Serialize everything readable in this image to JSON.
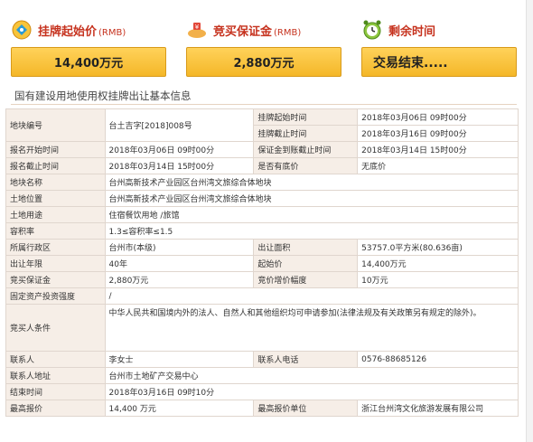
{
  "stats": {
    "start_price": {
      "label": "挂牌起始价",
      "unit": "(RMB)",
      "value": "14,400万元"
    },
    "deposit": {
      "label": "竞买保证金",
      "unit": "(RMB)",
      "value": "2,880万元"
    },
    "remaining": {
      "label": "剩余时间",
      "value": "交易结束....."
    }
  },
  "section_title": "国有建设用地使用权挂牌出让基本信息",
  "rows": {
    "r1": {
      "l1": "地块编号",
      "v1": "台土吉字[2018]008号",
      "l2": "挂牌起始时间",
      "v2": "2018年03月06日 09时00分"
    },
    "r1b": {
      "l2": "挂牌截止时间",
      "v2": "2018年03月16日 09时00分"
    },
    "r2": {
      "l1": "报名开始时间",
      "v1": "2018年03月06日 09时00分",
      "l2": "保证金到账截止时间",
      "v2": "2018年03月14日 15时00分"
    },
    "r3": {
      "l1": "报名截止时间",
      "v1": "2018年03月14日 15时00分",
      "l2": "是否有底价",
      "v2": "无底价"
    },
    "r4": {
      "l1": "地块名称",
      "v1": "台州高新技术产业园区台州湾文旅综合体地块"
    },
    "r5": {
      "l1": "土地位置",
      "v1": "台州高新技术产业园区台州湾文旅综合体地块"
    },
    "r6": {
      "l1": "土地用途",
      "v1": "住宿餐饮用地 /旅馆"
    },
    "r7": {
      "l1": "容积率",
      "v1": "1.3≤容积率≤1.5"
    },
    "r8": {
      "l1": "所属行政区",
      "v1": "台州市(本级)",
      "l2": "出让面积",
      "v2": "53757.0平方米(80.636亩)"
    },
    "r9": {
      "l1": "出让年限",
      "v1": "40年",
      "l2": "起始价",
      "v2": "14,400万元"
    },
    "r10": {
      "l1": "竞买保证金",
      "v1": "2,880万元",
      "l2": "竞价增价幅度",
      "v2": "10万元"
    },
    "r11": {
      "l1": "固定资产投资强度",
      "v1": "/"
    },
    "r12": {
      "l1": "竞买人条件",
      "v1": "中华人民共和国境内外的法人、自然人和其他组织均可申请参加(法律法规及有关政策另有规定的除外)。"
    },
    "r13": {
      "l1": "联系人",
      "v1": "李女士",
      "l2": "联系人电话",
      "v2": "0576-88685126"
    },
    "r14": {
      "l1": "联系人地址",
      "v1": "台州市土地矿产交易中心"
    },
    "r15": {
      "l1": "结束时间",
      "v1": "2018年03月16日 09时10分"
    },
    "r16": {
      "l1": "最高报价",
      "v1": "14,400 万元",
      "l2": "最高报价单位",
      "v2": "浙江台州湾文化旅游发展有限公司"
    }
  },
  "colors": {
    "label_red": "#c6321e",
    "box_gold": "#f4b728",
    "label_bg": "#f6eee7"
  }
}
